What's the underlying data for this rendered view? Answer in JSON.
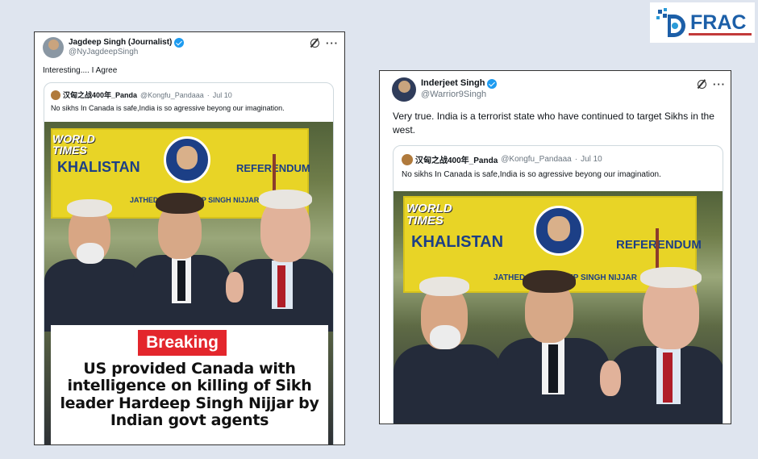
{
  "logo": {
    "text": "FRAC",
    "brand_color": "#1c5fa8"
  },
  "tweet_left": {
    "author_name": "Jagdeep Singh (Journalist)",
    "author_handle": "@NyJagdeepSingh",
    "text": "Interesting.... I Agree",
    "icons": [
      "verified-badge",
      "grok-icon",
      "more-icon"
    ],
    "more_label": "···",
    "quote": {
      "name": "汉匈之战400年_Panda",
      "handle": "@Kongfu_Pandaaa",
      "date": "Jul 10",
      "separator": "·",
      "text": "No sikhs In Canada is safe,India is  so agressive beyong our imagination."
    },
    "image": {
      "banner_left": "KHALISTAN",
      "banner_right": "REFERENDUM",
      "banner_bottom": "JATHEDAR HARDEEP SINGH NIJJAR",
      "watermark_line1": "WORLD",
      "watermark_line2": "TIMES",
      "breaking_label": "Breaking",
      "headline": "US provided Canada with intelligence on killing of Sikh leader Hardeep Singh Nijjar by Indian govt agents"
    }
  },
  "tweet_right": {
    "author_name": "Inderjeet Singh",
    "author_handle": "@Warrior9Singh",
    "text": "Very true. India is a terrorist state who have continued to target Sikhs in the west.",
    "icons": [
      "verified-badge",
      "grok-icon",
      "more-icon"
    ],
    "more_label": "···",
    "quote": {
      "name": "汉匈之战400年_Panda",
      "handle": "@Kongfu_Pandaaa",
      "date": "Jul 10",
      "separator": "·",
      "text": "No sikhs In Canada is safe,India is  so agressive beyong our imagination."
    },
    "image": {
      "banner_left": "KHALISTAN",
      "banner_right": "REFERENDUM",
      "banner_bottom": "JATHEDAR HARDEEP SINGH NIJJAR",
      "watermark_line1": "WORLD",
      "watermark_line2": "TIMES"
    }
  },
  "colors": {
    "background": "#dfe5ef",
    "verified": "#1d9bf0",
    "breaking_red": "#e3262c",
    "banner_yellow": "#e8d426"
  }
}
